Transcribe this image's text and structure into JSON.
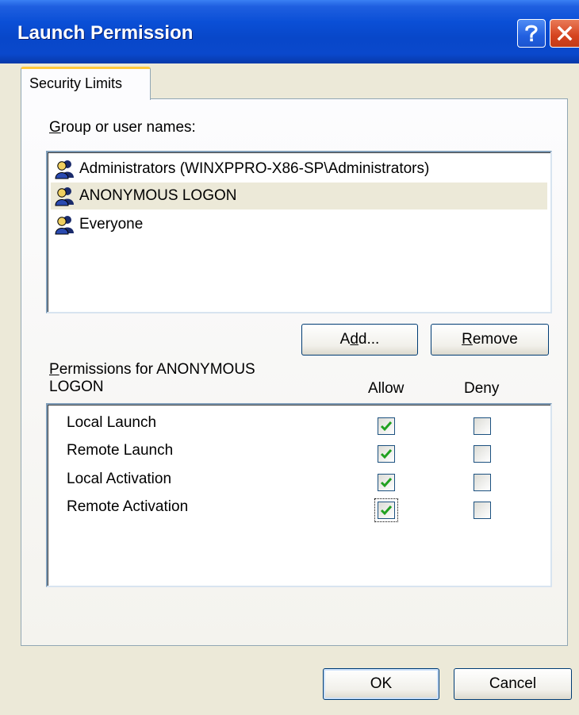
{
  "window": {
    "title": "Launch Permission"
  },
  "titlebar_buttons": {
    "help_icon": "question-icon",
    "close_icon": "close-x-icon"
  },
  "tabs": [
    {
      "label": "Security Limits",
      "active": true
    }
  ],
  "users_section": {
    "label_hotkey": "G",
    "label_rest": "roup or user names:",
    "items": [
      {
        "name": "Administrators (WINXPPRO-X86-SP\\Administrators)",
        "icon": "user-group-icon",
        "selected": false
      },
      {
        "name": "ANONYMOUS LOGON",
        "icon": "user-group-icon",
        "selected": true
      },
      {
        "name": "Everyone",
        "icon": "user-group-icon",
        "selected": false
      }
    ]
  },
  "buttons": {
    "add_pre": "A",
    "add_hotkey": "d",
    "add_post": "d...",
    "remove_hotkey": "R",
    "remove_rest": "emove",
    "ok": "OK",
    "cancel": "Cancel"
  },
  "permissions_section": {
    "label_hotkey": "P",
    "label_line1_rest": "ermissions for ANONYMOUS",
    "label_line2": "LOGON",
    "allow_header": "Allow",
    "deny_header": "Deny",
    "rows": [
      {
        "name": "Local Launch",
        "allow": true,
        "deny": false
      },
      {
        "name": "Remote Launch",
        "allow": true,
        "deny": false
      },
      {
        "name": "Local Activation",
        "allow": true,
        "deny": false
      },
      {
        "name": "Remote Activation",
        "allow": true,
        "deny": false,
        "focused": true
      }
    ]
  },
  "colors": {
    "titlebar": "#0a4fd6",
    "dialog_bg": "#ece9d8",
    "check_mark": "#21a121",
    "tab_highlight": "#ffc83c"
  }
}
